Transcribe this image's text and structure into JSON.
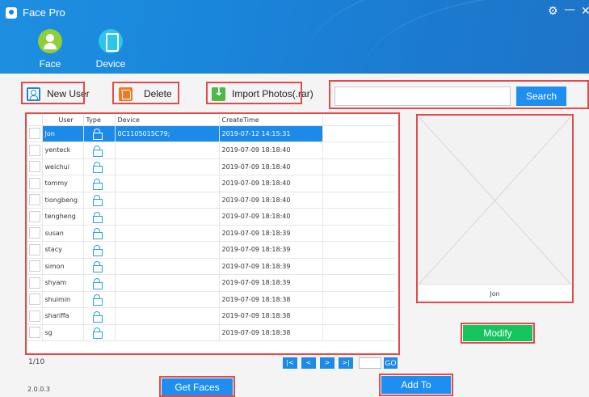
{
  "app": {
    "title": "Face Pro",
    "icon": "face-pro-app-icon"
  },
  "window_controls": {
    "settings": "⚙",
    "minimize": "—",
    "close": "✕"
  },
  "nav": [
    {
      "label": "Face",
      "icon": "face-icon"
    },
    {
      "label": "Device",
      "icon": "device-icon"
    }
  ],
  "toolbar": {
    "new_user": "New User",
    "delete": "Delete",
    "import": "Import Photos(.rar)"
  },
  "search": {
    "value": "",
    "placeholder": "",
    "button": "Search"
  },
  "table": {
    "headers": [
      "User",
      "Type",
      "Device",
      "CreateTime"
    ],
    "selected_row": 0,
    "rows": [
      {
        "user": "Jon",
        "device": "0C1105015C79;",
        "time": "2019-07-12 14:15:31"
      },
      {
        "user": "yenteck",
        "device": "",
        "time": "2019-07-09 18:18:40"
      },
      {
        "user": "weichui",
        "device": "",
        "time": "2019-07-09 18:18:40"
      },
      {
        "user": "tommy",
        "device": "",
        "time": "2019-07-09 18:18:40"
      },
      {
        "user": "tiongbeng",
        "device": "",
        "time": "2019-07-09 18:18:40"
      },
      {
        "user": "tengheng",
        "device": "",
        "time": "2019-07-09 18:18:40"
      },
      {
        "user": "susan",
        "device": "",
        "time": "2019-07-09 18:18:39"
      },
      {
        "user": "stacy",
        "device": "",
        "time": "2019-07-09 18:18:39"
      },
      {
        "user": "simon",
        "device": "",
        "time": "2019-07-09 18:18:39"
      },
      {
        "user": "shyam",
        "device": "",
        "time": "2019-07-09 18:18:39"
      },
      {
        "user": "shuimin",
        "device": "",
        "time": "2019-07-09 18:18:38"
      },
      {
        "user": "shariffa",
        "device": "",
        "time": "2019-07-09 18:18:38"
      },
      {
        "user": "sg",
        "device": "",
        "time": "2019-07-09 18:18:38"
      }
    ]
  },
  "pagination": {
    "page": "1/10",
    "first": "|<",
    "prev": "<",
    "next": ">",
    "last": ">|",
    "go": "GO",
    "input": ""
  },
  "preview": {
    "name": "Jon"
  },
  "buttons": {
    "modify": "Modify",
    "get_faces": "Get Faces",
    "add_to": "Add To"
  },
  "version": "2.0.0.3",
  "colors": {
    "header": "#1a86db",
    "accent": "#1f8ef1",
    "selected": "#1c8ae8",
    "modify": "#16c45e",
    "highlight": "#e24b4b"
  }
}
